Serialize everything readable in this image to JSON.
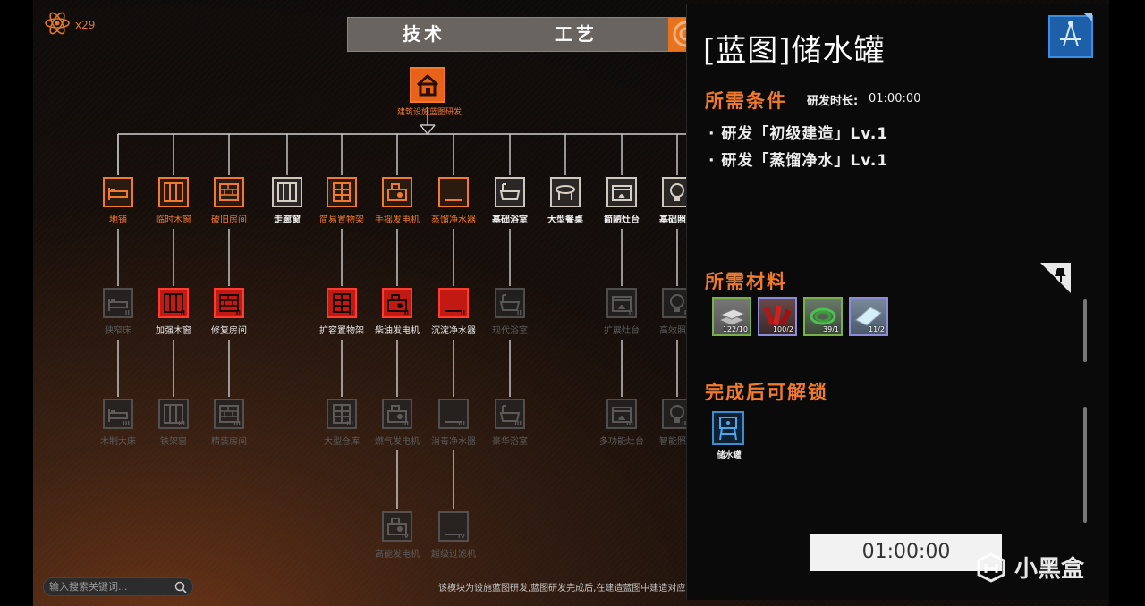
{
  "resource": {
    "count": "x29",
    "icon": "atom-icon"
  },
  "tabs": {
    "tech": "技术",
    "craft": "工艺"
  },
  "root": {
    "label": "建筑设施蓝图研发",
    "icon": "house-icon"
  },
  "tree": {
    "row1": [
      {
        "label": "地铺",
        "state": "unlocked",
        "icon": "bed"
      },
      {
        "label": "临时木窗",
        "state": "unlocked",
        "icon": "window"
      },
      {
        "label": "破旧房间",
        "state": "unlocked",
        "icon": "wall"
      },
      {
        "label": "走廊窗",
        "state": "avail",
        "icon": "window"
      },
      {
        "label": "简易置物架",
        "state": "unlocked",
        "icon": "shelf"
      },
      {
        "label": "手摇发电机",
        "state": "unlocked",
        "icon": "generator"
      },
      {
        "label": "蒸馏净水器",
        "state": "unlocked",
        "icon": "water"
      },
      {
        "label": "基础浴室",
        "state": "avail",
        "icon": "bath"
      },
      {
        "label": "大型餐桌",
        "state": "avail",
        "icon": "table"
      },
      {
        "label": "简陋灶台",
        "state": "avail",
        "icon": "stove"
      },
      {
        "label": "基础照明",
        "state": "avail",
        "icon": "bulb"
      }
    ],
    "row2": [
      {
        "label": "狭窄床",
        "state": "locked",
        "icon": "bed",
        "roman": "II"
      },
      {
        "label": "加强木窗",
        "state": "red",
        "icon": "window",
        "roman": "II"
      },
      {
        "label": "修复房间",
        "state": "red",
        "icon": "wall",
        "roman": "II"
      },
      {
        "label": "扩容置物架",
        "state": "red",
        "icon": "shelf",
        "roman": "II"
      },
      {
        "label": "柴油发电机",
        "state": "red",
        "icon": "generator",
        "roman": "II"
      },
      {
        "label": "沉淀净水器",
        "state": "red",
        "icon": "water",
        "roman": "II"
      },
      {
        "label": "现代浴室",
        "state": "locked",
        "icon": "bath",
        "roman": "II"
      },
      {
        "label": "扩展灶台",
        "state": "locked",
        "icon": "stove",
        "roman": "II"
      },
      {
        "label": "高效照明",
        "state": "locked",
        "icon": "bulb",
        "roman": "II"
      }
    ],
    "row3": [
      {
        "label": "木制大床",
        "state": "locked",
        "icon": "bed",
        "roman": "III"
      },
      {
        "label": "铁架窗",
        "state": "locked",
        "icon": "window",
        "roman": "III"
      },
      {
        "label": "精装房间",
        "state": "locked",
        "icon": "wall",
        "roman": "III"
      },
      {
        "label": "大型仓库",
        "state": "locked",
        "icon": "shelf",
        "roman": "III"
      },
      {
        "label": "燃气发电机",
        "state": "locked",
        "icon": "generator",
        "roman": "III"
      },
      {
        "label": "消毒净水器",
        "state": "locked",
        "icon": "water",
        "roman": "III"
      },
      {
        "label": "豪华浴室",
        "state": "locked",
        "icon": "bath",
        "roman": "III"
      },
      {
        "label": "多功能灶台",
        "state": "locked",
        "icon": "stove",
        "roman": "III"
      },
      {
        "label": "智能照明",
        "state": "locked",
        "icon": "bulb",
        "roman": "III"
      }
    ],
    "row4": [
      {
        "label": "高能发电机",
        "state": "locked",
        "icon": "generator",
        "roman": "IV"
      },
      {
        "label": "超级过滤机",
        "state": "locked",
        "icon": "water",
        "roman": "IV"
      }
    ]
  },
  "search": {
    "placeholder": "输入搜索关键词..."
  },
  "hint": "该模块为设施蓝图研发,蓝图研发完成后,在建造蓝图中建造对应",
  "panel": {
    "title": "[蓝图]储水罐",
    "requirements_heading": "所需条件",
    "time_label": "研发时长:",
    "time_value": "01:00:00",
    "requirements": [
      "· 研发「初级建造」Lv.1",
      "· 研发「蒸馏净水」Lv.1"
    ],
    "materials_heading": "所需材料",
    "materials": [
      {
        "name": "metal",
        "count": "122/10",
        "border": "#7ab04a",
        "icon": "metal-ingot-icon"
      },
      {
        "name": "red-part",
        "count": "100/2",
        "border": "#8c8cd8",
        "icon": "red-component-icon"
      },
      {
        "name": "hose",
        "count": "39/1",
        "border": "#7ab04a",
        "icon": "hose-icon"
      },
      {
        "name": "glass",
        "count": "11/2",
        "border": "#8c8cd8",
        "icon": "glass-sheet-icon"
      }
    ],
    "unlocks_heading": "完成后可解锁",
    "unlocks": [
      {
        "label": "储水罐",
        "icon": "water-tank-icon"
      }
    ],
    "timer": "01:00:00"
  },
  "watermark": "小黑盒",
  "colors": {
    "accent": "#f07a2d",
    "red_state": "#c21a12",
    "panel_bg": "#0a0a0a"
  }
}
